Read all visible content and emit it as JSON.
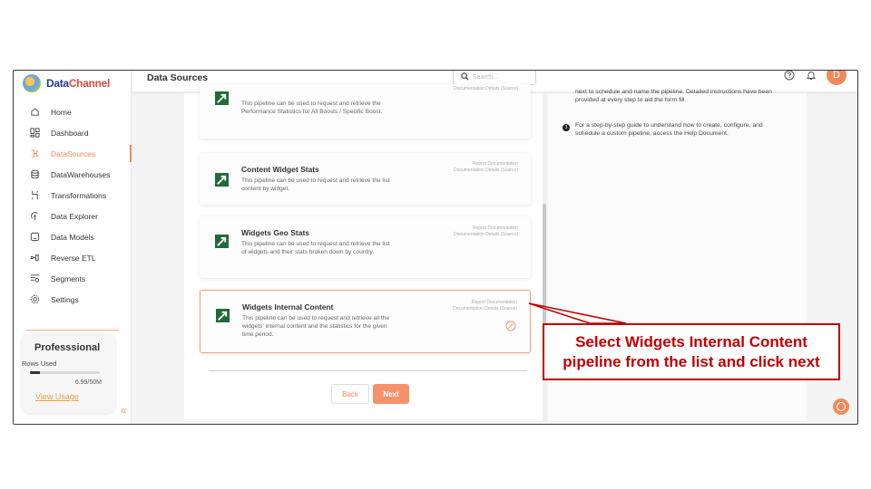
{
  "brand": {
    "name_part1": "Data",
    "name_part2": "Channel"
  },
  "sidebar": {
    "items": [
      {
        "label": "Home",
        "icon": "home-icon"
      },
      {
        "label": "Dashboard",
        "icon": "dashboard-icon"
      },
      {
        "label": "DataSources",
        "icon": "datasources-icon",
        "active": true
      },
      {
        "label": "DataWarehouses",
        "icon": "database-icon"
      },
      {
        "label": "Transformations",
        "icon": "transform-icon"
      },
      {
        "label": "Data Explorer",
        "icon": "explorer-icon"
      },
      {
        "label": "Data Models",
        "icon": "models-icon"
      },
      {
        "label": "Reverse ETL",
        "icon": "reverse-etl-icon"
      },
      {
        "label": "Segments",
        "icon": "segments-icon"
      },
      {
        "label": "Settings",
        "icon": "settings-icon"
      }
    ],
    "plan": {
      "title": "Professsional",
      "rows_used_label": "Rows Used",
      "usage_value": "6.99/50M",
      "usage_fraction": 0.14,
      "view_usage": "View Usage"
    },
    "collapse_glyph": "«"
  },
  "header": {
    "title": "Data Sources",
    "search_placeholder": "Search...",
    "avatar_initial": "D"
  },
  "pipelines": [
    {
      "name": "",
      "description": "This pipeline can be used to request and retrieve the Performance Statistics for All Boosts / Specific Boost.",
      "links": [
        "Documentation Details (Source)"
      ]
    },
    {
      "name": "Content Widget Stats",
      "description": "This pipeline can be used to request and retrieve the list content by widget.",
      "links": [
        "Report Documentation",
        "Documentation Details (Source)"
      ]
    },
    {
      "name": "Widgets Geo Stats",
      "description": "This pipeline can be used to request and retrieve the list of widgets and their stats broken down by country.",
      "links": [
        "Report Documentation",
        "Documentation Details (Source)"
      ]
    },
    {
      "name": "Widgets Internal Content",
      "description": "This pipeline can be used to request and retrieve all the widgets' internal content and the statistics for the given time period.",
      "links": [
        "Report Documentation",
        "Documentation Details (Source)"
      ],
      "selected": true
    }
  ],
  "buttons": {
    "back": "Back",
    "next": "Next"
  },
  "help": {
    "partial_text": "next to schedule and name the pipeline. Detailed instructions have been provided at every step to aid the form fill",
    "step3_number": "3",
    "step3_text": "For a step-by-step guide to understand how to create, configure, and schedule a custom pipeline, access the Help Document."
  },
  "annotation": {
    "line1": "Select Widgets Internal Content",
    "line2": "pipeline from the list and click next"
  },
  "colors": {
    "accent": "#f08a5d",
    "annotation": "#c00000",
    "thumb_green": "#1f6b3a"
  }
}
